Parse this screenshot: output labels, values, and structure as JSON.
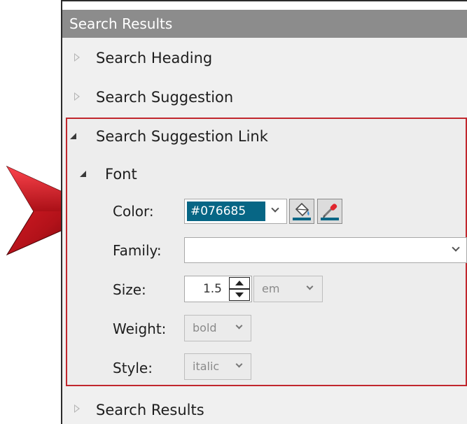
{
  "panel": {
    "title": "Search Results"
  },
  "tree": {
    "items": [
      {
        "label": "Search Heading",
        "expanded": false
      },
      {
        "label": "Search Suggestion",
        "expanded": false
      },
      {
        "label": "Search Suggestion Link",
        "expanded": true
      },
      {
        "label": "Search Results",
        "expanded": false
      }
    ],
    "font_group": {
      "label": "Font",
      "expanded": true
    }
  },
  "font": {
    "color_label": "Color:",
    "color_value": "#076685",
    "family_label": "Family:",
    "family_value": "",
    "size_label": "Size:",
    "size_value": "1.5",
    "size_unit": "em",
    "weight_label": "Weight:",
    "weight_value": "bold",
    "style_label": "Style:",
    "style_value": "italic"
  },
  "icons": {
    "fill": "paint-bucket-icon",
    "picker": "eyedropper-icon",
    "pointer": "red-arrow-icon"
  },
  "colors": {
    "accent": "#076685",
    "selection_border": "#c1272d",
    "header_bg": "#8c8c8c",
    "pointer": "#b3121a"
  }
}
